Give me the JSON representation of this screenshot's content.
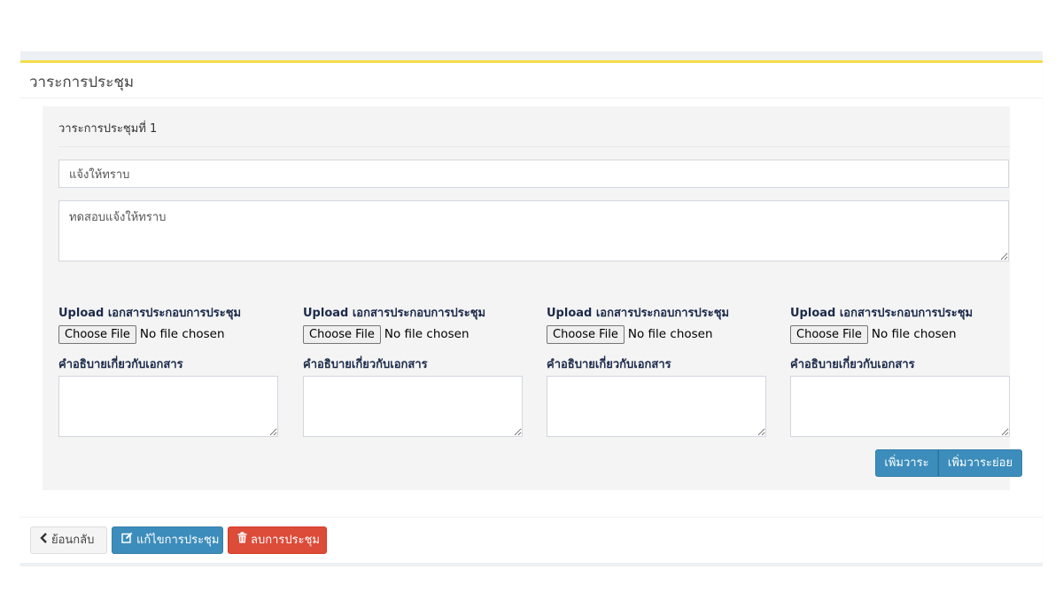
{
  "box": {
    "title": "วาระการประชุม"
  },
  "agenda": {
    "heading": "วาระการประชุมที่ 1",
    "topic_value": "แจ้งให้ทราบ",
    "detail_value": "ทดสอบแจ้งให้ทราบ"
  },
  "uploads": [
    {
      "label": "Upload เอกสารประกอบการประชุม",
      "choose": "Choose File",
      "status": "No file chosen",
      "desc_label": "คำอธิบายเกี่ยวกับเอกสาร"
    },
    {
      "label": "Upload เอกสารประกอบการประชุม",
      "choose": "Choose File",
      "status": "No file chosen",
      "desc_label": "คำอธิบายเกี่ยวกับเอกสาร"
    },
    {
      "label": "Upload เอกสารประกอบการประชุม",
      "choose": "Choose File",
      "status": "No file chosen",
      "desc_label": "คำอธิบายเกี่ยวกับเอกสาร"
    },
    {
      "label": "Upload เอกสารประกอบการประชุม",
      "choose": "Choose File",
      "status": "No file chosen",
      "desc_label": "คำอธิบายเกี่ยวกับเอกสาร"
    }
  ],
  "actions": {
    "add_agenda": "เพิ่มวาระ",
    "add_sub_agenda": "เพิ่มวาระย่อย"
  },
  "footer": {
    "back_label": "ย้อนกลับ",
    "edit_label": "แก้ไขการประชุม",
    "delete_label": "ลบการประชุม"
  },
  "colors": {
    "accent_top": "#f3dc4a",
    "primary": "#3c8dbc",
    "danger": "#dd4b39"
  },
  "icons": {
    "back": "chevron-left-icon",
    "edit": "edit-icon",
    "delete": "trash-icon"
  }
}
